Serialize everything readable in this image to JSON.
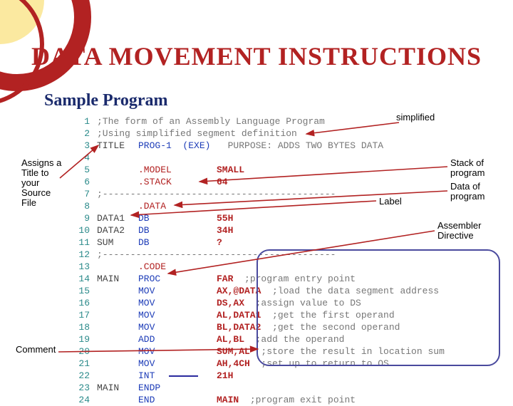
{
  "title": "DATA MOVEMENT INSTRUCTIONS",
  "subtitle": "Sample Program",
  "annotations": {
    "simplified": "simplified",
    "assignsTitle": "Assigns a Title to your Source File",
    "stack": "Stack of program",
    "data": "Data of program",
    "label": "Label",
    "assembler": "Assembler Directive",
    "comment": "Comment"
  },
  "code": [
    {
      "n": 1,
      "label": "",
      "op": ";The form of an Assembly Language Program",
      "arg": "",
      "c": ""
    },
    {
      "n": 2,
      "label": "",
      "op": ";Using simplified segment definition",
      "arg": "",
      "c": ""
    },
    {
      "n": 3,
      "label": "TITLE",
      "op": "PROG-1  (EXE)",
      "arg": "",
      "c": "PURPOSE: ADDS TWO BYTES DATA"
    },
    {
      "n": 4,
      "label": "",
      "op": "",
      "arg": "",
      "c": ""
    },
    {
      "n": 5,
      "label": "",
      "op": ".MODEL",
      "arg": "SMALL",
      "c": ""
    },
    {
      "n": 6,
      "label": "",
      "op": ".STACK",
      "arg": "64",
      "c": ""
    },
    {
      "n": 7,
      "label": ";----",
      "op": "",
      "arg": "",
      "c": "--------------------------------------"
    },
    {
      "n": 8,
      "label": "",
      "op": ".DATA",
      "arg": "",
      "c": ""
    },
    {
      "n": 9,
      "label": "DATA1",
      "op": "DB",
      "arg": "55H",
      "c": ""
    },
    {
      "n": 10,
      "label": "DATA2",
      "op": "DB",
      "arg": "34H",
      "c": ""
    },
    {
      "n": 11,
      "label": "SUM",
      "op": "DB",
      "arg": "?",
      "c": ""
    },
    {
      "n": 12,
      "label": ";----",
      "op": "",
      "arg": "",
      "c": "--------------------------------------"
    },
    {
      "n": 13,
      "label": "",
      "op": ".CODE",
      "arg": "",
      "c": ""
    },
    {
      "n": 14,
      "label": "MAIN",
      "op": "PROC",
      "arg": "FAR",
      "c": ";program entry point"
    },
    {
      "n": 15,
      "label": "",
      "op": "MOV",
      "arg": "AX,@DATA",
      "c": ";load the data segment address"
    },
    {
      "n": 16,
      "label": "",
      "op": "MOV",
      "arg": "DS,AX",
      "c": ";assign value to DS"
    },
    {
      "n": 17,
      "label": "",
      "op": "MOV",
      "arg": "AL,DATA1",
      "c": ";get the first operand"
    },
    {
      "n": 18,
      "label": "",
      "op": "MOV",
      "arg": "BL,DATA2",
      "c": ";get the second operand"
    },
    {
      "n": 19,
      "label": "",
      "op": "ADD",
      "arg": "AL,BL",
      "c": ";add the operand"
    },
    {
      "n": 20,
      "label": "",
      "op": "MOV",
      "arg": "SUM,AL",
      "c": ";store the result in location sum"
    },
    {
      "n": 21,
      "label": "",
      "op": "MOV",
      "arg": "AH,4CH",
      "c": ";set up to return to OS"
    },
    {
      "n": 22,
      "label": "",
      "op": "INT",
      "arg": "21H",
      "c": ""
    },
    {
      "n": 23,
      "label": "MAIN",
      "op": "ENDP",
      "arg": "",
      "c": ""
    },
    {
      "n": 24,
      "label": "",
      "op": "END",
      "arg": "MAIN",
      "c": ";program exit point"
    }
  ]
}
